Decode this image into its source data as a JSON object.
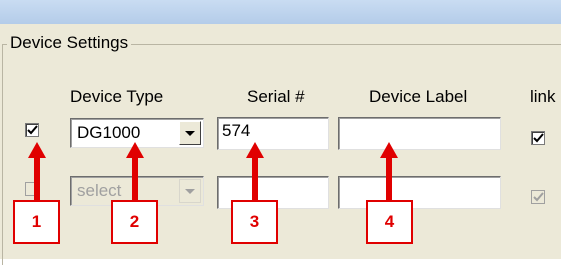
{
  "group": {
    "title": "Device Settings"
  },
  "columns": {
    "device_type": "Device Type",
    "serial": "Serial #",
    "device_label": "Device Label",
    "link": "link"
  },
  "rows": [
    {
      "checked": true,
      "device_type": "DG1000",
      "serial": "574",
      "device_label": "",
      "link_checked": true,
      "enabled": true
    },
    {
      "checked": false,
      "device_type": "select",
      "serial": "",
      "device_label": "",
      "link_checked": true,
      "enabled": false
    }
  ],
  "markers": [
    "1",
    "2",
    "3",
    "4"
  ],
  "colors": {
    "marker": "#e00000",
    "panel": "#ece9d8"
  },
  "icons": {
    "check": "checkmark-icon",
    "dropdown": "chevron-down-icon",
    "arrow": "arrow-up-icon"
  }
}
